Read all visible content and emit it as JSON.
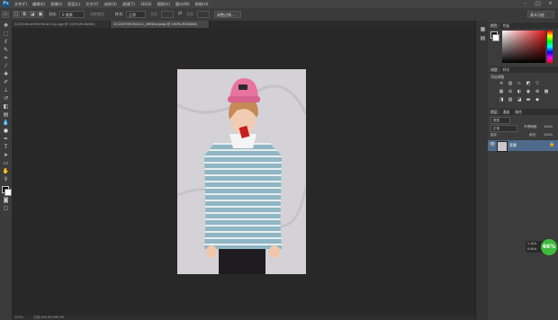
{
  "app": {
    "logo": "Ps"
  },
  "menu": [
    "文件(F)",
    "编辑(E)",
    "图像(I)",
    "图层(L)",
    "文字(Y)",
    "选择(S)",
    "滤镜(T)",
    "3D(D)",
    "视图(V)",
    "窗口(W)",
    "帮助(H)"
  ],
  "window_controls": [
    "–",
    "□",
    "×"
  ],
  "options": {
    "feather_label": "羽化:",
    "feather_value": "0 像素",
    "antialias": "消除锯齿",
    "style_label": "样式:",
    "style_value": "正常",
    "width_label": "宽度:",
    "height_label": "高度:",
    "refine_edge": "调整边缘...",
    "workspace": "基本功能"
  },
  "tabs": [
    {
      "label": "2225c9a4cf5fd7b0a7c2p.jpg @ 100%(RGB/8#)",
      "active": false
    },
    {
      "label": "20140709194411_nMGka.jpeg @ 100%(RGB/8#)",
      "active": true
    }
  ],
  "tools": [
    "move-icon",
    "marquee-icon",
    "lasso-icon",
    "quick-select-icon",
    "crop-icon",
    "eyedropper-icon",
    "healing-icon",
    "brush-icon",
    "stamp-icon",
    "history-brush-icon",
    "eraser-icon",
    "gradient-icon",
    "blur-icon",
    "dodge-icon",
    "pen-icon",
    "type-icon",
    "path-select-icon",
    "shape-icon",
    "hand-icon",
    "zoom-icon"
  ],
  "status": {
    "zoom": "100%",
    "doc": "文档:498.6K/498.6K"
  },
  "panels": {
    "color_tabs": [
      "颜色",
      "色板"
    ],
    "adjust_tabs": [
      "调整",
      "样式"
    ],
    "adjust_title": "添加调整",
    "layers_tabs": [
      "图层",
      "通道",
      "路径"
    ],
    "kind": "类型",
    "blend": "正常",
    "opacity_label": "不透明度:",
    "opacity": "100%",
    "lock_label": "锁定:",
    "fill_label": "填充:",
    "fill": "100%",
    "layer_name": "背景"
  },
  "colors": {
    "accent": "#4f6b8c",
    "swatch_red": "#c81e1e",
    "widget_green": "#3dbb3d"
  },
  "net_widget": {
    "percent": "66%",
    "up": "1.1K/s",
    "down": "0.9K/s"
  }
}
